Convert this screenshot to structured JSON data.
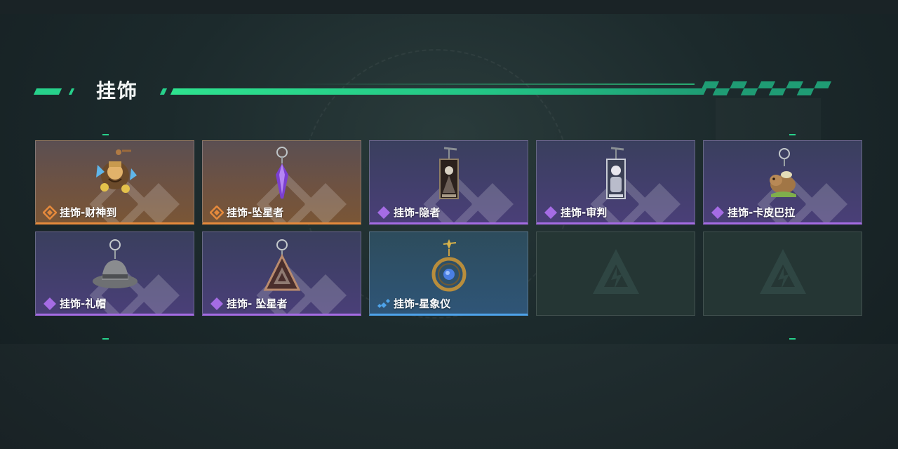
{
  "section": {
    "title": "挂饰"
  },
  "colors": {
    "accent": "#27d18b",
    "rarity_orange": "#e58a3c",
    "rarity_purple": "#a56ce4",
    "rarity_blue": "#4ea3ea"
  },
  "items": [
    {
      "name": "挂饰-财神到",
      "rarity": "orange",
      "icon": "god-of-wealth-charm"
    },
    {
      "name": "挂饰-坠星者",
      "rarity": "orange",
      "icon": "purple-crystal-charm"
    },
    {
      "name": "挂饰-隐者",
      "rarity": "purple",
      "icon": "hermit-tarot-charm"
    },
    {
      "name": "挂饰-审判",
      "rarity": "purple",
      "icon": "judgement-tarot-charm"
    },
    {
      "name": "挂饰-卡皮巴拉",
      "rarity": "purple",
      "icon": "capybara-charm"
    },
    {
      "name": "挂饰-礼帽",
      "rarity": "purple",
      "icon": "fedora-hat-charm"
    },
    {
      "name": "挂饰- 坠星者",
      "rarity": "purple",
      "icon": "triangle-emblem-charm"
    },
    {
      "name": "挂饰-星象仪",
      "rarity": "blue",
      "icon": "astrolabe-charm"
    },
    {
      "name": "",
      "rarity": "empty",
      "icon": "empty-slot-logo"
    },
    {
      "name": "",
      "rarity": "empty",
      "icon": "empty-slot-logo"
    }
  ]
}
